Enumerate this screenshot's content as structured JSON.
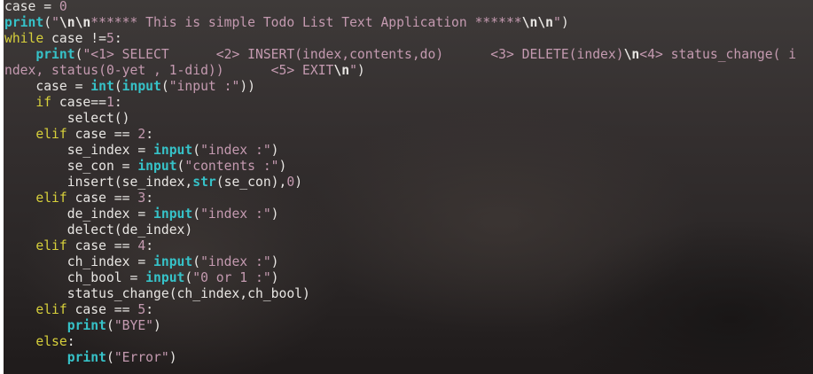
{
  "code_lines": [
    [
      {
        "t": "plain",
        "v": "case = "
      },
      {
        "t": "num",
        "v": "0"
      }
    ],
    [
      {
        "t": "fn",
        "v": "print"
      },
      {
        "t": "plain",
        "v": "("
      },
      {
        "t": "str",
        "v": "\""
      },
      {
        "t": "esc",
        "v": "\\n\\n"
      },
      {
        "t": "str",
        "v": "****** This is simple Todo List Text Application ******"
      },
      {
        "t": "esc",
        "v": "\\n\\n"
      },
      {
        "t": "str",
        "v": "\""
      },
      {
        "t": "plain",
        "v": ")"
      }
    ],
    [
      {
        "t": "kw",
        "v": "while"
      },
      {
        "t": "plain",
        "v": " case !="
      },
      {
        "t": "num",
        "v": "5"
      },
      {
        "t": "plain",
        "v": ":"
      }
    ],
    [
      {
        "t": "plain",
        "v": "    "
      },
      {
        "t": "fn",
        "v": "print"
      },
      {
        "t": "plain",
        "v": "("
      },
      {
        "t": "str",
        "v": "\"<1> SELECT      <2> INSERT(index,contents,do)      <3> DELETE(index)"
      },
      {
        "t": "esc",
        "v": "\\n"
      },
      {
        "t": "str",
        "v": "<4> status_change( i"
      }
    ],
    [
      {
        "t": "str",
        "v": "ndex, status(0-yet , 1-did))      <5> EXIT"
      },
      {
        "t": "esc",
        "v": "\\n"
      },
      {
        "t": "str",
        "v": "\""
      },
      {
        "t": "plain",
        "v": ")"
      }
    ],
    [
      {
        "t": "plain",
        "v": "    case = "
      },
      {
        "t": "fn",
        "v": "int"
      },
      {
        "t": "plain",
        "v": "("
      },
      {
        "t": "fn",
        "v": "input"
      },
      {
        "t": "plain",
        "v": "("
      },
      {
        "t": "str",
        "v": "\"input :\""
      },
      {
        "t": "plain",
        "v": "))"
      }
    ],
    [
      {
        "t": "plain",
        "v": "    "
      },
      {
        "t": "kw",
        "v": "if"
      },
      {
        "t": "plain",
        "v": " case=="
      },
      {
        "t": "num",
        "v": "1"
      },
      {
        "t": "plain",
        "v": ":"
      }
    ],
    [
      {
        "t": "plain",
        "v": "        select()"
      }
    ],
    [
      {
        "t": "plain",
        "v": "    "
      },
      {
        "t": "kw",
        "v": "elif"
      },
      {
        "t": "plain",
        "v": " case == "
      },
      {
        "t": "num",
        "v": "2"
      },
      {
        "t": "plain",
        "v": ":"
      }
    ],
    [
      {
        "t": "plain",
        "v": "        se_index = "
      },
      {
        "t": "fn",
        "v": "input"
      },
      {
        "t": "plain",
        "v": "("
      },
      {
        "t": "str",
        "v": "\"index :\""
      },
      {
        "t": "plain",
        "v": ")"
      }
    ],
    [
      {
        "t": "plain",
        "v": "        se_con = "
      },
      {
        "t": "fn",
        "v": "input"
      },
      {
        "t": "plain",
        "v": "("
      },
      {
        "t": "str",
        "v": "\"contents :\""
      },
      {
        "t": "plain",
        "v": ")"
      }
    ],
    [
      {
        "t": "plain",
        "v": "        insert(se_index,"
      },
      {
        "t": "fn",
        "v": "str"
      },
      {
        "t": "plain",
        "v": "(se_con),"
      },
      {
        "t": "num",
        "v": "0"
      },
      {
        "t": "plain",
        "v": ")"
      }
    ],
    [
      {
        "t": "plain",
        "v": "    "
      },
      {
        "t": "kw",
        "v": "elif"
      },
      {
        "t": "plain",
        "v": " case == "
      },
      {
        "t": "num",
        "v": "3"
      },
      {
        "t": "plain",
        "v": ":"
      }
    ],
    [
      {
        "t": "plain",
        "v": "        de_index = "
      },
      {
        "t": "fn",
        "v": "input"
      },
      {
        "t": "plain",
        "v": "("
      },
      {
        "t": "str",
        "v": "\"index :\""
      },
      {
        "t": "plain",
        "v": ")"
      }
    ],
    [
      {
        "t": "plain",
        "v": "        delect(de_index)"
      }
    ],
    [
      {
        "t": "plain",
        "v": "    "
      },
      {
        "t": "kw",
        "v": "elif"
      },
      {
        "t": "plain",
        "v": " case == "
      },
      {
        "t": "num",
        "v": "4"
      },
      {
        "t": "plain",
        "v": ":"
      }
    ],
    [
      {
        "t": "plain",
        "v": "        ch_index = "
      },
      {
        "t": "fn",
        "v": "input"
      },
      {
        "t": "plain",
        "v": "("
      },
      {
        "t": "str",
        "v": "\"index :\""
      },
      {
        "t": "plain",
        "v": ")"
      }
    ],
    [
      {
        "t": "plain",
        "v": "        ch_bool = "
      },
      {
        "t": "fn",
        "v": "input"
      },
      {
        "t": "plain",
        "v": "("
      },
      {
        "t": "str",
        "v": "\"0 or 1 :\""
      },
      {
        "t": "plain",
        "v": ")"
      }
    ],
    [
      {
        "t": "plain",
        "v": "        status_change(ch_index,ch_bool)"
      }
    ],
    [
      {
        "t": "plain",
        "v": "    "
      },
      {
        "t": "kw",
        "v": "elif"
      },
      {
        "t": "plain",
        "v": " case == "
      },
      {
        "t": "num",
        "v": "5"
      },
      {
        "t": "plain",
        "v": ":"
      }
    ],
    [
      {
        "t": "plain",
        "v": "        "
      },
      {
        "t": "fn",
        "v": "print"
      },
      {
        "t": "plain",
        "v": "("
      },
      {
        "t": "str",
        "v": "\"BYE\""
      },
      {
        "t": "plain",
        "v": ")"
      }
    ],
    [
      {
        "t": "plain",
        "v": "    "
      },
      {
        "t": "kw",
        "v": "else"
      },
      {
        "t": "plain",
        "v": ":"
      }
    ],
    [
      {
        "t": "plain",
        "v": "        "
      },
      {
        "t": "fn",
        "v": "print"
      },
      {
        "t": "plain",
        "v": "("
      },
      {
        "t": "str",
        "v": "\"Error\""
      },
      {
        "t": "plain",
        "v": ")"
      }
    ]
  ],
  "colors": {
    "keyword": "#d7d03b",
    "builtin": "#36c2c8",
    "string": "#c49ab0",
    "text": "#e8e6e3"
  }
}
